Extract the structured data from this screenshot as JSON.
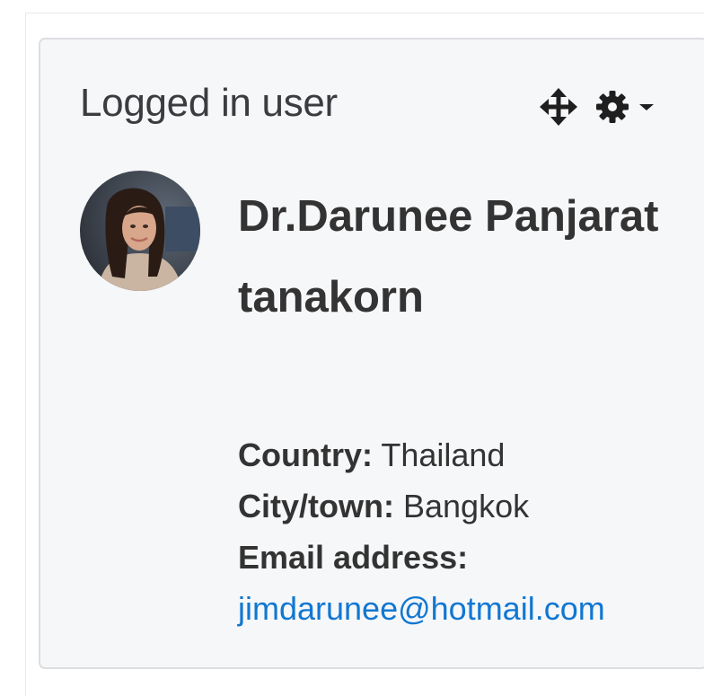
{
  "block": {
    "title": "Logged in user",
    "controls": {
      "move_icon": "move-icon",
      "settings_icon": "gear-icon",
      "menu_icon": "caret-down-icon"
    }
  },
  "user": {
    "fullname": "Dr.Darunee Panjarattanakorn",
    "country_label": "Country:",
    "country_value": "Thailand",
    "city_label": "City/town:",
    "city_value": "Bangkok",
    "email_label": "Email address:",
    "email_value": "jimdarunee@hotmail.com"
  },
  "colors": {
    "link": "#1177d1",
    "text": "#333333",
    "block_bg": "#f6f7f9",
    "border": "#dcdee1"
  }
}
